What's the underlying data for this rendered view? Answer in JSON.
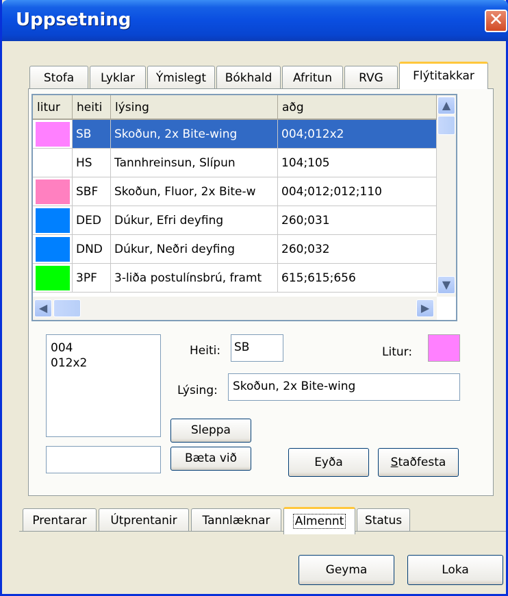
{
  "window": {
    "title": "Uppsetning"
  },
  "top_tabs": [
    "Stofa",
    "Lyklar",
    "Ýmislegt",
    "Bókhald",
    "Afritun",
    "RVG",
    "Flýtitakkar"
  ],
  "active_top_tab": "Flýtitakkar",
  "table": {
    "columns": [
      "litur",
      "heiti",
      "lýsing",
      "aðg"
    ],
    "rows": [
      {
        "color": "#ff80ff",
        "heiti": "SB",
        "lysing": "Skoðun, 2x Bite-wing",
        "adg": "004;012x2"
      },
      {
        "color": "",
        "heiti": "HS",
        "lysing": "Tannhreinsun, Slípun",
        "adg": "104;105"
      },
      {
        "color": "#ff80c0",
        "heiti": "SBF",
        "lysing": "Skoðun, Fluor, 2x Bite-w",
        "adg": "004;012;012;110"
      },
      {
        "color": "#0080ff",
        "heiti": "DED",
        "lysing": "Dúkur, Efri deyfing",
        "adg": "260;031"
      },
      {
        "color": "#0080ff",
        "heiti": "DND",
        "lysing": "Dúkur, Neðri deyfing",
        "adg": "260;032"
      },
      {
        "color": "#00ff00",
        "heiti": "3PF",
        "lysing": "3-liða postulínsbrú, framt",
        "adg": "615;615;656"
      }
    ],
    "selected_row": 0
  },
  "codes_list": [
    "004",
    "012x2"
  ],
  "add_code_value": "",
  "form": {
    "heiti_label": "Heiti:",
    "heiti_value": "SB",
    "litur_label": "Litur:",
    "litur_color": "#ff80ff",
    "lysing_label": "Lýsing:",
    "lysing_value": "Skoðun, 2x Bite-wing"
  },
  "buttons": {
    "sleppa": "Sleppa",
    "baeta_vid": "Bæta við",
    "eyda": "Eyða",
    "stadfesta": "Staðfesta",
    "stadfesta_mnemonic": "S",
    "geyma": "Geyma",
    "loka": "Loka"
  },
  "bottom_tabs": [
    "Prentarar",
    "Útprentanir",
    "Tannlæknar",
    "Almennt",
    "Status"
  ],
  "active_bottom_tab": "Almennt"
}
